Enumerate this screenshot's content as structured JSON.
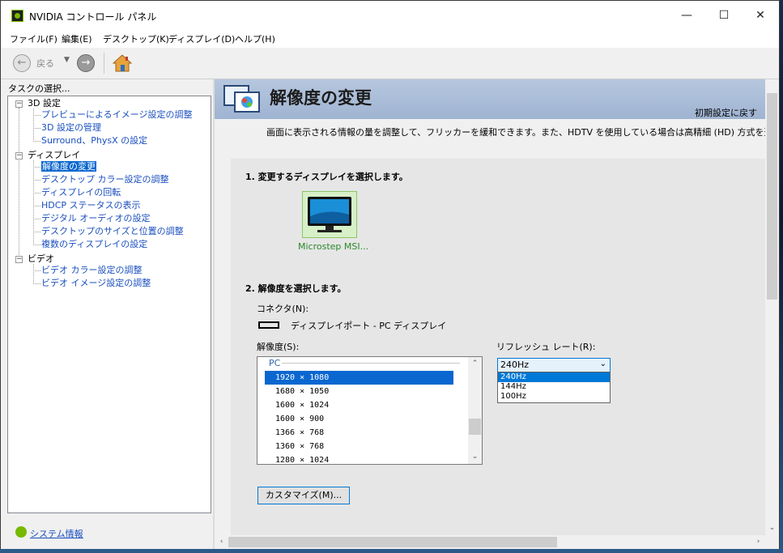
{
  "window": {
    "title": "NVIDIA コントロール パネル",
    "minimize": "—",
    "maximize": "☐",
    "close": "✕"
  },
  "menu": [
    "ファイル(F)",
    "編集(E)",
    "デスクトップ(K)",
    "ディスプレイ(D)",
    "ヘルプ(H)"
  ],
  "toolbar": {
    "back_label": "戻る",
    "back_icon": "arrow-left-icon",
    "forward_icon": "arrow-right-icon",
    "home_icon": "home-icon"
  },
  "tasks": {
    "label": "タスクの選択...",
    "categories": [
      {
        "name": "3D 設定",
        "items": [
          "プレビューによるイメージ設定の調整",
          "3D 設定の管理",
          "Surround、PhysX の設定"
        ]
      },
      {
        "name": "ディスプレイ",
        "items": [
          "解像度の変更",
          "デスクトップ カラー設定の調整",
          "ディスプレイの回転",
          "HDCP ステータスの表示",
          "デジタル オーディオの設定",
          "デスクトップのサイズと位置の調整",
          "複数のディスプレイの設定"
        ]
      },
      {
        "name": "ビデオ",
        "items": [
          "ビデオ カラー設定の調整",
          "ビデオ イメージ設定の調整"
        ]
      }
    ],
    "selected": "解像度の変更"
  },
  "system_info": "システム情報",
  "page": {
    "title": "解像度の変更",
    "reset": "初期設定に戻す",
    "description": "画面に表示される情報の量を調整して、フリッカーを緩和できます。また、HDTV を使用している場合は高精細 (HD) 方式を選択し、"
  },
  "section1": {
    "heading": "1. 変更するディスプレイを選択します。",
    "display_name": "Microstep MSI..."
  },
  "section2": {
    "heading": "2. 解像度を選択します。",
    "connector_label": "コネクタ(N):",
    "connector_value": "ディスプレイポート - PC ディスプレイ",
    "resolution_label": "解像度(S):",
    "group": "PC",
    "resolutions": [
      "1920 × 1080",
      "1680 × 1050",
      "1600 × 1024",
      "1600 × 900",
      "1366 × 768",
      "1360 × 768",
      "1280 × 1024"
    ],
    "selected_resolution": "1920 × 1080",
    "refresh_label": "リフレッシュ レート(R):",
    "refresh_value": "240Hz",
    "refresh_options": [
      "240Hz",
      "144Hz",
      "100Hz"
    ],
    "customize_button": "カスタマイズ(M)..."
  }
}
